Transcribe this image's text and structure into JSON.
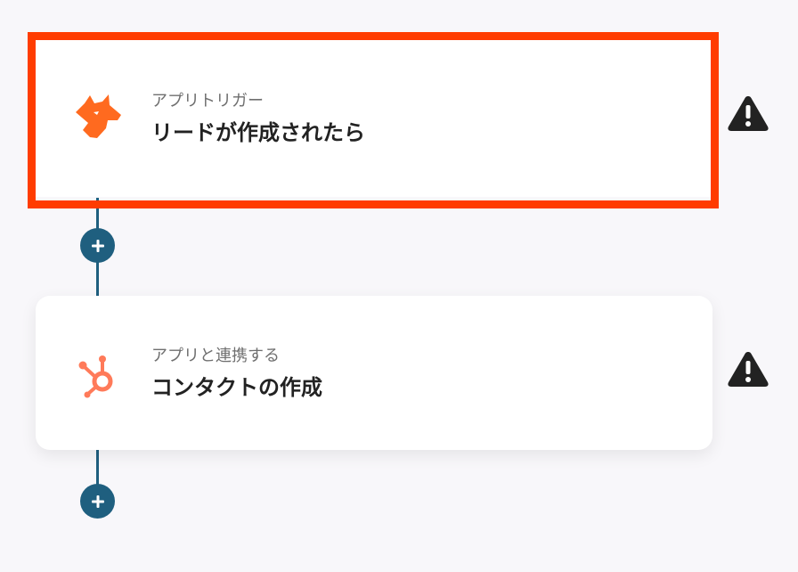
{
  "flow": {
    "steps": [
      {
        "subtitle": "アプリトリガー",
        "title": "リードが作成されたら",
        "icon": "fox-icon",
        "icon_color": "#ff6a1f",
        "selected": true,
        "warning": true
      },
      {
        "subtitle": "アプリと連携する",
        "title": "コンタクトの作成",
        "icon": "hubspot-icon",
        "icon_color": "#ff7a59",
        "selected": false,
        "warning": true
      }
    ],
    "add_button_icon": "plus-icon",
    "warning_icon": "warning-icon"
  },
  "colors": {
    "background": "#f8f7fa",
    "connector": "#1f5f7f",
    "selection": "#ff3c00",
    "warning": "#222222"
  }
}
